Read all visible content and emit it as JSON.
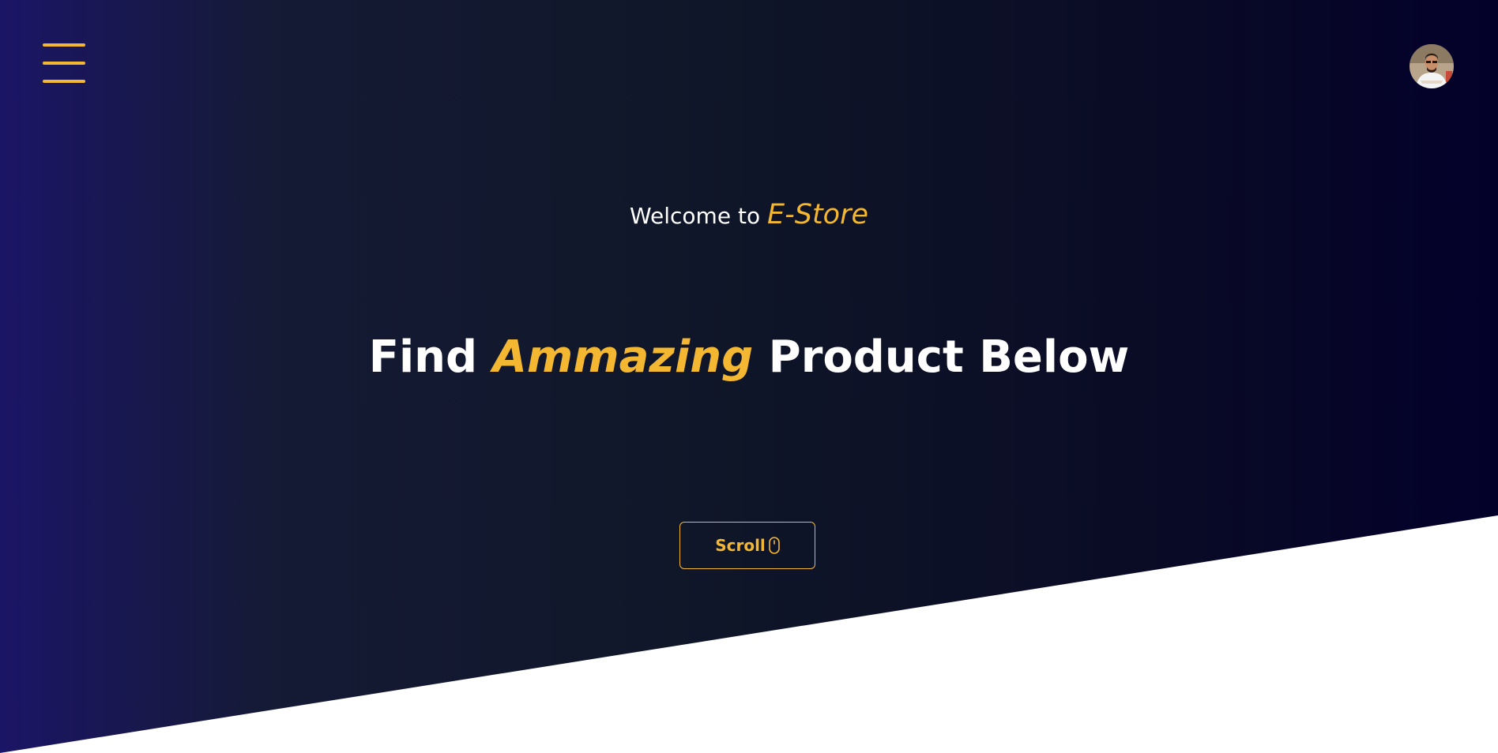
{
  "header": {
    "menu_icon": "hamburger-menu-icon",
    "avatar_icon": "user-avatar"
  },
  "hero": {
    "welcome_prefix": "Welcome to",
    "brand": "E-Store",
    "headline_start": "Find",
    "headline_accent": "Ammazing",
    "headline_end": "Product Below",
    "scroll_label": "Scroll",
    "scroll_icon": "mouse-icon"
  },
  "colors": {
    "accent": "#f3b731",
    "background_dark": "#101729",
    "background_left": "#1b1566",
    "background_right": "#03002a",
    "text": "#ffffff"
  }
}
